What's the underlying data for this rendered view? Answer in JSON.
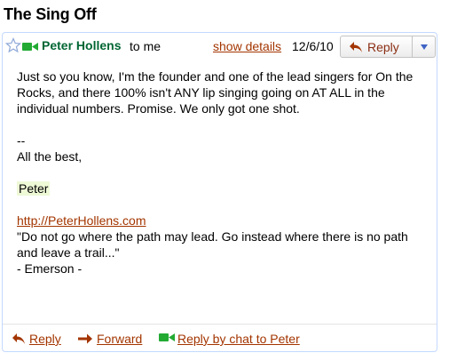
{
  "subject": "The Sing Off",
  "header": {
    "sender": "Peter Hollens",
    "recipient": "to me",
    "show_details": "show details",
    "date": "12/6/10",
    "reply_label": "Reply"
  },
  "body": {
    "paragraph1": "Just so you know, I'm the founder and one of the lead singers for On the Rocks, and there 100% isn't ANY lip singing going on AT ALL in the individual numbers.  Promise.   We only got one shot.",
    "separator": "--",
    "closing": "All the best,",
    "name": "Peter",
    "link": "http://PeterHollens.com",
    "quote_line1": "\"Do not go where the path may lead.  Go instead where there is no path",
    "quote_line2": "and leave a trail...\"",
    "attribution": "- Emerson -"
  },
  "footer": {
    "reply": "Reply",
    "forward": "Forward",
    "reply_chat": "Reply by chat to Peter"
  },
  "colors": {
    "sender": "#006633",
    "link": "#a33500",
    "border": "#c3d9ff",
    "video_icon": "#22aa33"
  }
}
